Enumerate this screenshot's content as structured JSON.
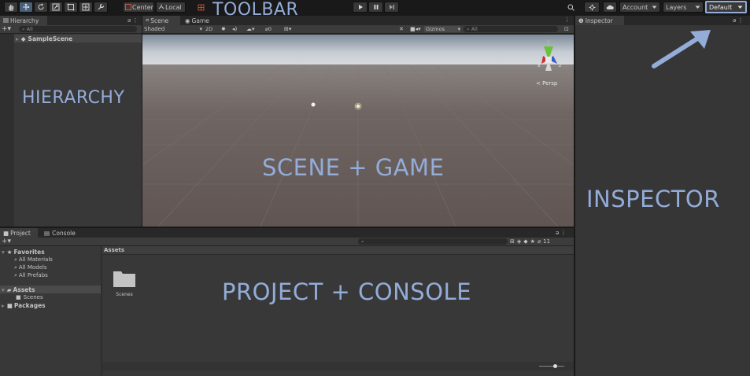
{
  "toolbar": {
    "center_label": "Center",
    "local_label": "Local",
    "account_label": "Account",
    "layers_label": "Layers",
    "layout_label": "Default",
    "overlay_label": "TOOLBAR"
  },
  "hierarchy": {
    "tab_label": "Hierarchy",
    "search_placeholder": "All",
    "scene_name": "SampleScene",
    "overlay_label": "HIERARCHY"
  },
  "scene": {
    "tabs": [
      {
        "label": "Scene"
      },
      {
        "label": "Game"
      }
    ],
    "shading_mode": "Shaded",
    "mode_2d": "2D",
    "fx_count": "0",
    "gizmos_label": "Gizmos",
    "search_placeholder": "All",
    "persp_label": "Persp",
    "overlay_label": "SCENE + GAME"
  },
  "inspector": {
    "tab_label": "Inspector",
    "overlay_label": "INSPECTOR"
  },
  "project": {
    "tabs": [
      {
        "label": "Project"
      },
      {
        "label": "Console"
      }
    ],
    "hidden_count": "11",
    "favorites_label": "Favorites",
    "favorites": [
      {
        "label": "All Materials"
      },
      {
        "label": "All Models"
      },
      {
        "label": "All Prefabs"
      }
    ],
    "assets_label": "Assets",
    "assets_children": [
      {
        "label": "Scenes"
      }
    ],
    "packages_label": "Packages",
    "breadcrumb": "Assets",
    "items": [
      {
        "label": "Scenes"
      }
    ],
    "overlay_label": "PROJECT + CONSOLE"
  },
  "colors": {
    "accent": "#93acd8",
    "active_tool": "#46607c",
    "panel_bg": "#383838",
    "dark_bg": "#191919"
  }
}
